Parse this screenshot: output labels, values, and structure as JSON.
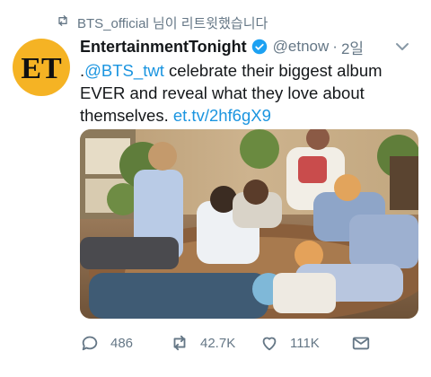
{
  "retweet_context": {
    "text": "BTS_official 님이 리트윗했습니다",
    "icon": "retweet-icon"
  },
  "tweet": {
    "avatar": {
      "text": "ET",
      "bg": "#f5b324"
    },
    "author_name": "EntertainmentTonight",
    "handle": "@etnow",
    "separator": "·",
    "time": "2일",
    "text": {
      "prefix": ".",
      "mention": "@BTS_twt",
      "body": " celebrate their biggest album EVER and reveal what they love about themselves. ",
      "link": "et.tv/2hf6gX9"
    },
    "media": {
      "icon": "photo"
    },
    "actions": {
      "reply_count": "486",
      "retweet_count": "42.7K",
      "like_count": "111K"
    }
  },
  "colors": {
    "link": "#1b95e0",
    "muted": "#657786",
    "verified": "#1da1f2"
  }
}
